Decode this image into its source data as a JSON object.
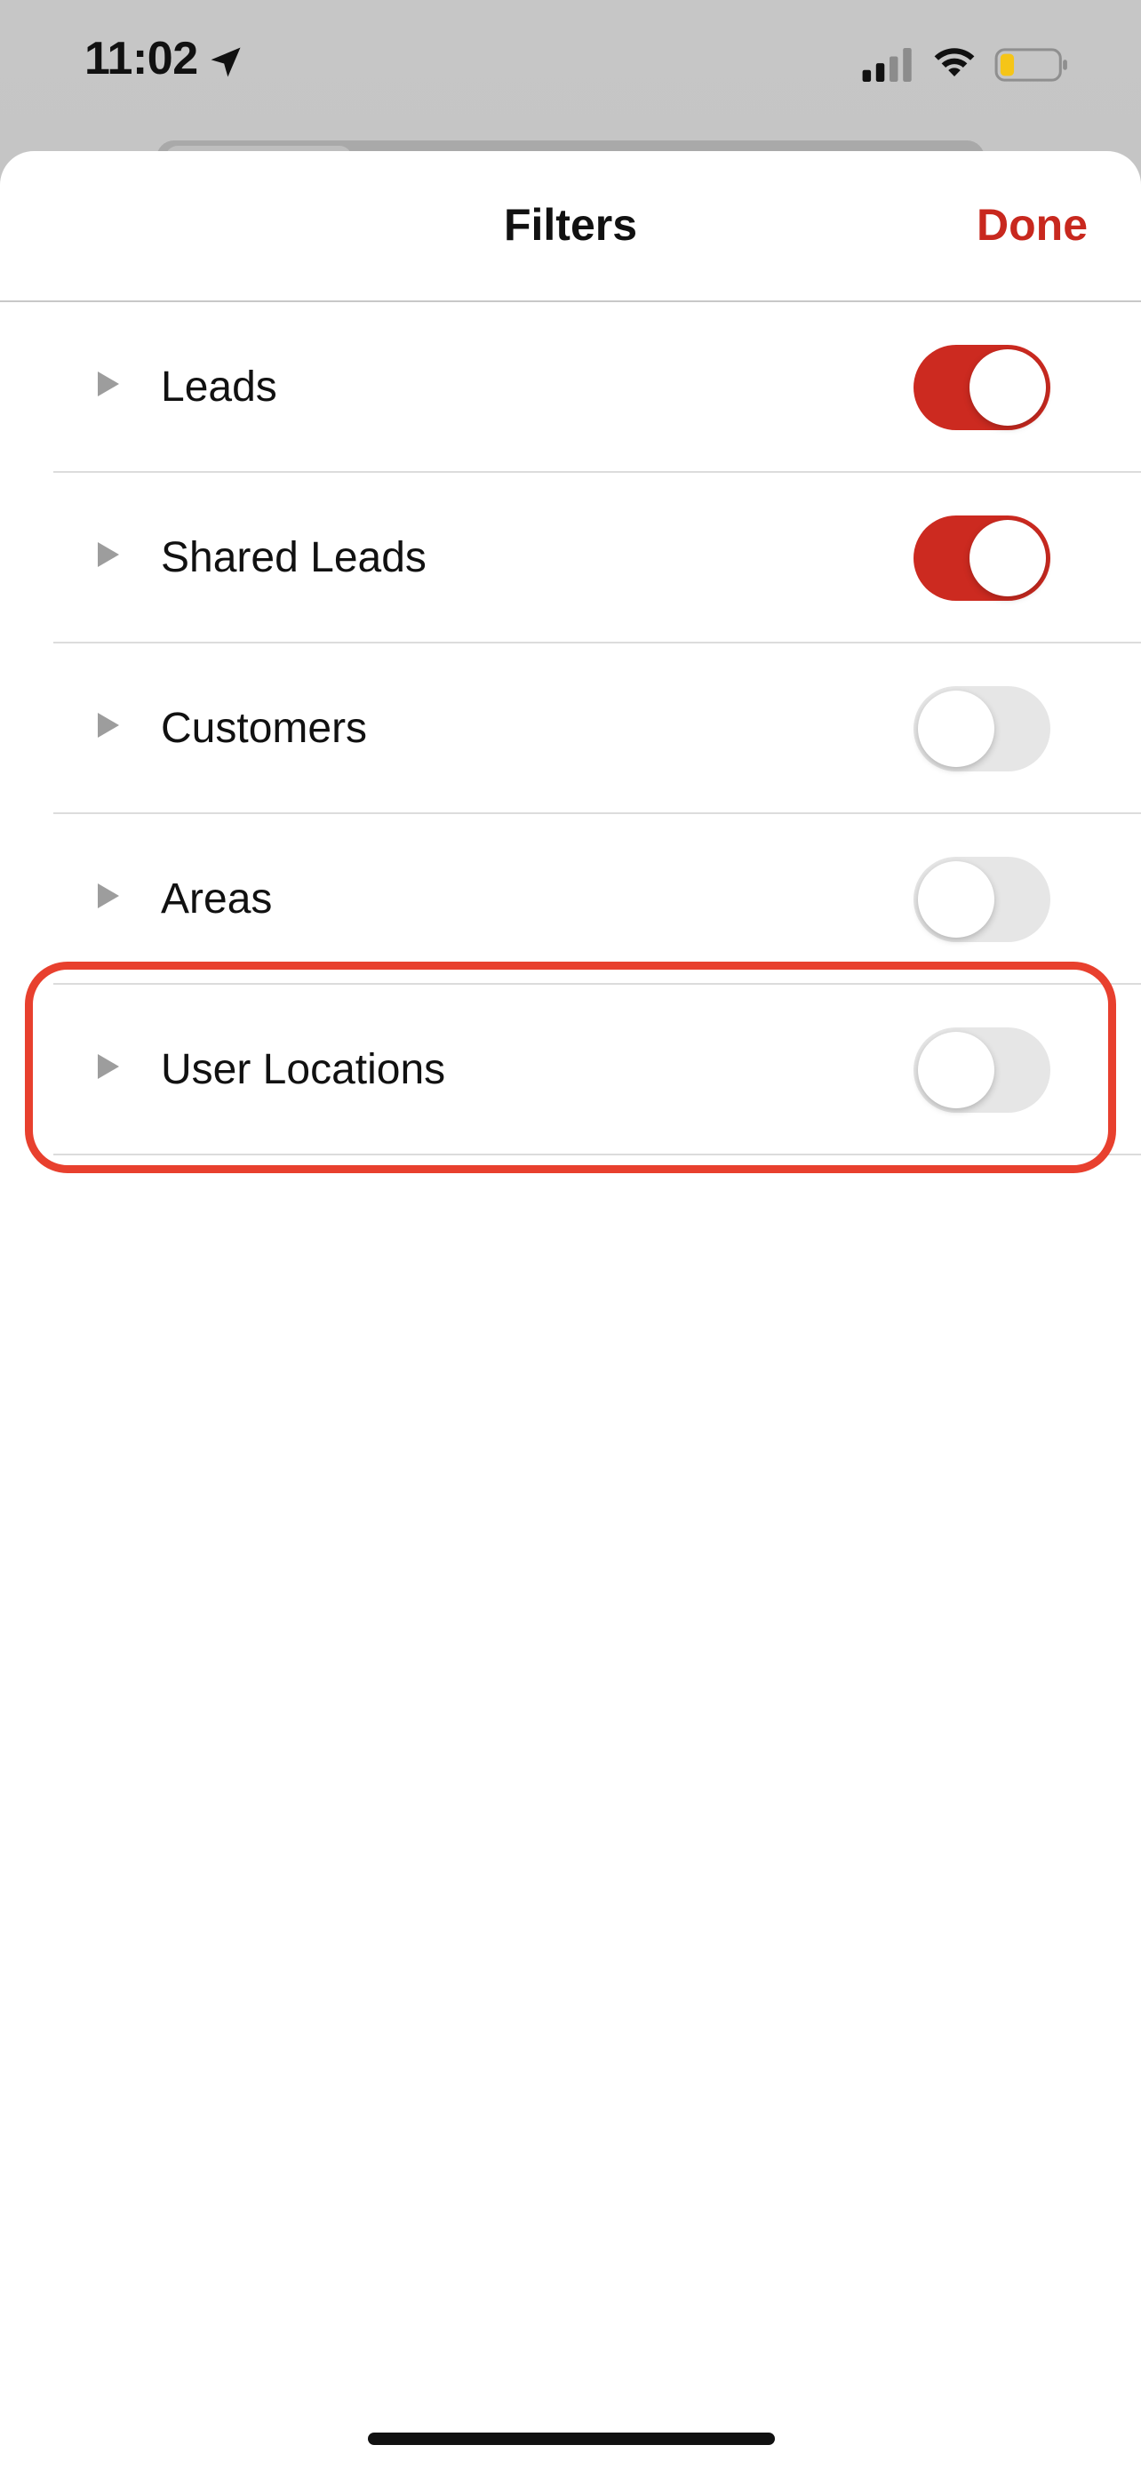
{
  "status_bar": {
    "time": "11:02",
    "icons": [
      "location-arrow-icon",
      "cellular-signal-icon",
      "wifi-icon",
      "battery-icon"
    ]
  },
  "sheet": {
    "title": "Filters",
    "done_label": "Done"
  },
  "filters": [
    {
      "label": "Leads",
      "enabled": true
    },
    {
      "label": "Shared Leads",
      "enabled": true
    },
    {
      "label": "Customers",
      "enabled": false
    },
    {
      "label": "Areas",
      "enabled": false
    },
    {
      "label": "User Locations",
      "enabled": false
    }
  ],
  "colors": {
    "accent": "#c8281e",
    "toggle_on": "#cc2a20",
    "toggle_off": "#e6e6e6",
    "highlight": "#e8402e",
    "battery_level": "#f5c518"
  }
}
